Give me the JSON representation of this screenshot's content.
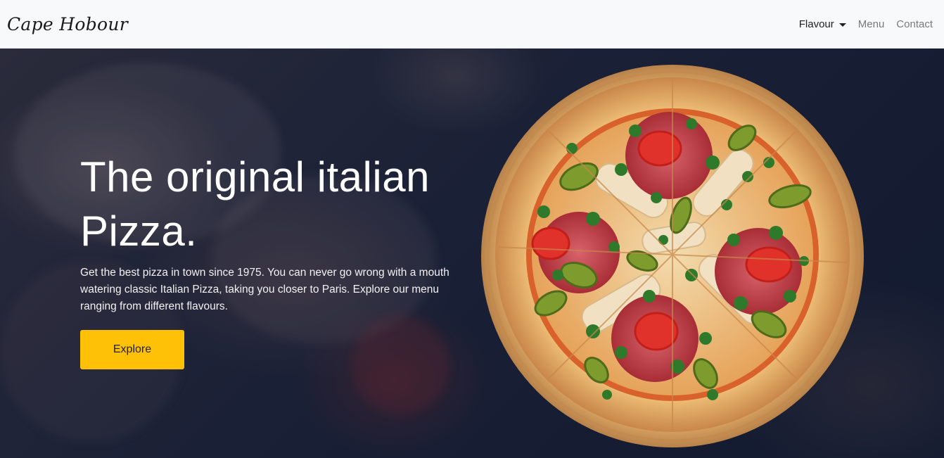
{
  "brand": {
    "name": "Cape Hobour"
  },
  "nav": {
    "items": [
      {
        "label": "Flavour",
        "dropdown": true,
        "active": true
      },
      {
        "label": "Menu",
        "dropdown": false,
        "active": false
      },
      {
        "label": "Contact",
        "dropdown": false,
        "active": false
      }
    ]
  },
  "hero": {
    "title_line1": "The original italian",
    "title_line2": "Pizza.",
    "description": "Get the best pizza in town since 1975. You can never go wrong with a mouth watering classic Italian Pizza, taking you closer to Paris. Explore our menu ranging from different flavours.",
    "cta_label": "Explore",
    "image": "pizza-image"
  },
  "colors": {
    "navbar_bg": "#f8f9fa",
    "hero_bg": "#121a2e",
    "cta_bg": "#ffc107",
    "text_light": "#ffffff"
  }
}
